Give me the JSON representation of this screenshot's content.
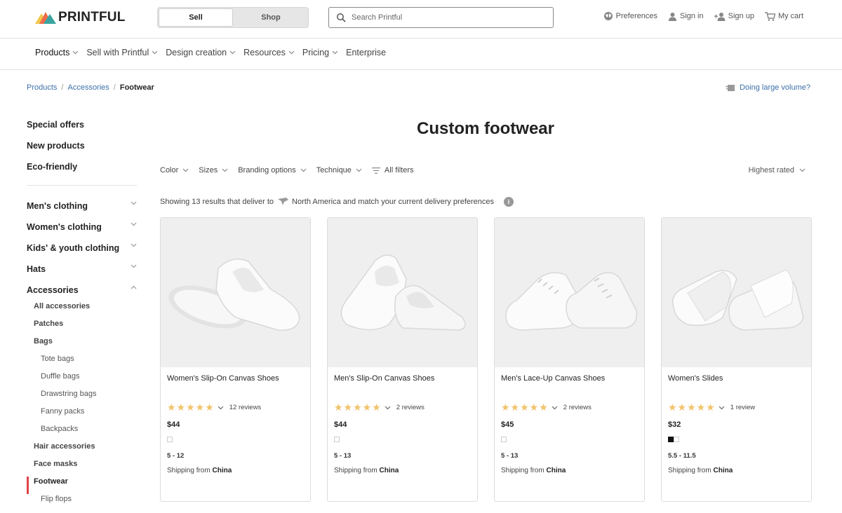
{
  "header": {
    "logo_text": "PRINTFUL",
    "toggle": {
      "sell": "Sell",
      "shop": "Shop"
    },
    "search_placeholder": "Search Printful",
    "links": {
      "preferences": "Preferences",
      "sign_in": "Sign in",
      "sign_up": "Sign up",
      "cart": "My cart"
    }
  },
  "nav": [
    "Products",
    "Sell with Printful",
    "Design creation",
    "Resources",
    "Pricing",
    "Enterprise"
  ],
  "breadcrumb": {
    "items": [
      "Products",
      "Accessories"
    ],
    "current": "Footwear",
    "separator": "/"
  },
  "volume_link": "Doing large volume?",
  "sidebar": {
    "top_links": [
      "Special offers",
      "New products",
      "Eco-friendly"
    ],
    "categories": [
      "Men's clothing",
      "Women's clothing",
      "Kids' & youth clothing",
      "Hats"
    ],
    "accessories": {
      "label": "Accessories",
      "all": "All accessories",
      "patches": "Patches",
      "bags": "Bags",
      "bag_items": [
        "Tote bags",
        "Duffle bags",
        "Drawstring bags",
        "Fanny packs",
        "Backpacks"
      ],
      "hair": "Hair accessories",
      "masks": "Face masks",
      "footwear": "Footwear",
      "flip_flops": "Flip flops"
    }
  },
  "page_title": "Custom footwear",
  "filters": {
    "color": "Color",
    "sizes": "Sizes",
    "branding": "Branding options",
    "technique": "Technique",
    "all": "All filters"
  },
  "sort": "Highest rated",
  "results": {
    "prefix": "Showing 13 results that deliver to",
    "region": "North America and match your current delivery preferences",
    "info": "i"
  },
  "products": [
    {
      "name": "Women's Slip-On Canvas Shoes",
      "stars": "★★★★★",
      "reviews": "12 reviews",
      "price": "$44",
      "sizes": "5 - 12",
      "ship_label": "Shipping from",
      "ship_from": "China"
    },
    {
      "name": "Men's Slip-On Canvas Shoes",
      "stars": "★★★★★",
      "reviews": "2 reviews",
      "price": "$44",
      "sizes": "5 - 13",
      "ship_label": "Shipping from",
      "ship_from": "China"
    },
    {
      "name": "Men's Lace-Up Canvas Shoes",
      "stars": "★★★★★",
      "reviews": "2 reviews",
      "price": "$45",
      "sizes": "5 - 13",
      "ship_label": "Shipping from",
      "ship_from": "China"
    },
    {
      "name": "Women's Slides",
      "stars": "★★★★★",
      "reviews": "1 review",
      "price": "$32",
      "sizes": "5.5 - 11.5",
      "ship_label": "Shipping from",
      "ship_from": "China"
    }
  ],
  "colors": {
    "accent_red": "#e0454b",
    "link_blue": "#3c6fa8",
    "star": "#f2c26b"
  }
}
